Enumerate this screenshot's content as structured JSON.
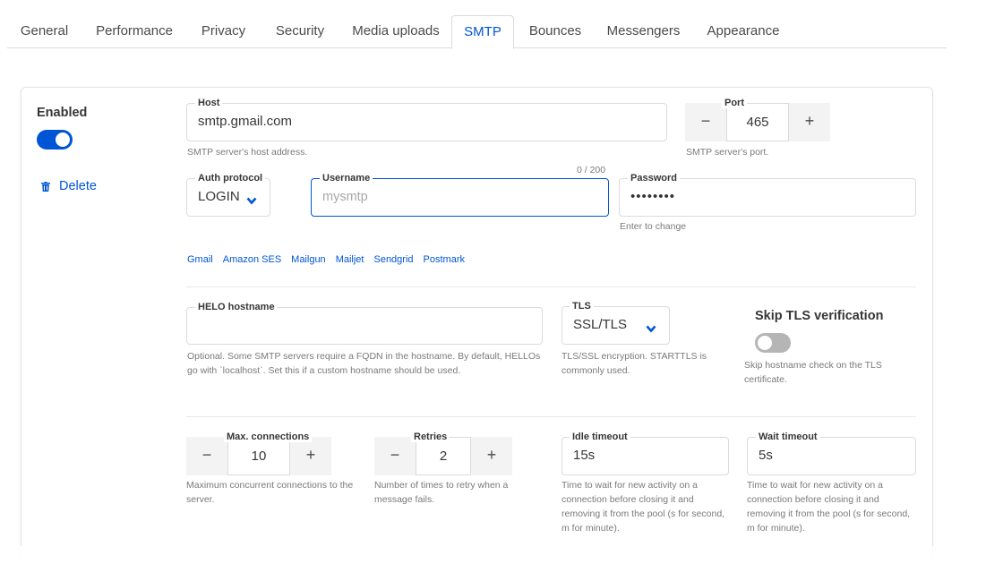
{
  "tabs": [
    {
      "label": "General",
      "active": false
    },
    {
      "label": "Performance",
      "active": false
    },
    {
      "label": "Privacy",
      "active": false
    },
    {
      "label": "Security",
      "active": false
    },
    {
      "label": "Media uploads",
      "active": false
    },
    {
      "label": "SMTP",
      "active": true
    },
    {
      "label": "Bounces",
      "active": false
    },
    {
      "label": "Messengers",
      "active": false
    },
    {
      "label": "Appearance",
      "active": false
    }
  ],
  "server": {
    "enabled_label": "Enabled",
    "enabled": true,
    "delete_label": "Delete",
    "host": {
      "label": "Host",
      "value": "smtp.gmail.com",
      "help": "SMTP server's host address."
    },
    "port": {
      "label": "Port",
      "value": "465",
      "help": "SMTP server's port.",
      "minus": "−",
      "plus": "+"
    },
    "auth_protocol": {
      "label": "Auth protocol",
      "value": "LOGIN"
    },
    "username": {
      "label": "Username",
      "value": "",
      "placeholder": "mysmtp",
      "counter": "0 / 200"
    },
    "password": {
      "label": "Password",
      "value": "••••••••",
      "help": "Enter to change"
    },
    "presets": [
      "Gmail",
      "Amazon SES",
      "Mailgun",
      "Mailjet",
      "Sendgrid",
      "Postmark"
    ],
    "helo": {
      "label": "HELO hostname",
      "value": "",
      "help": "Optional. Some SMTP servers require a FQDN in the hostname. By default, HELLOs go with `localhost`. Set this if a custom hostname should be used."
    },
    "tls": {
      "label": "TLS",
      "value": "SSL/TLS",
      "help": "TLS/SSL encryption. STARTTLS is commonly used."
    },
    "skip_tls": {
      "label": "Skip TLS verification",
      "enabled": false,
      "help": "Skip hostname check on the TLS certificate."
    },
    "max_conns": {
      "label": "Max. connections",
      "value": "10",
      "help": "Maximum concurrent connections to the server.",
      "minus": "−",
      "plus": "+"
    },
    "retries": {
      "label": "Retries",
      "value": "2",
      "help": "Number of times to retry when a message fails.",
      "minus": "−",
      "plus": "+"
    },
    "idle_timeout": {
      "label": "Idle timeout",
      "value": "15s",
      "help": "Time to wait for new activity on a connection before closing it and removing it from the pool (s for second, m for minute)."
    },
    "wait_timeout": {
      "label": "Wait timeout",
      "value": "5s",
      "help": "Time to wait for new activity on a connection before closing it and removing it from the pool (s for second, m for minute)."
    }
  },
  "colors": {
    "accent": "#0055d4",
    "toggle_off": "#b5b5b5",
    "help_text": "#7a7a7a"
  },
  "icons": {
    "delete": "trash-icon",
    "select": "chevron-down-icon"
  }
}
